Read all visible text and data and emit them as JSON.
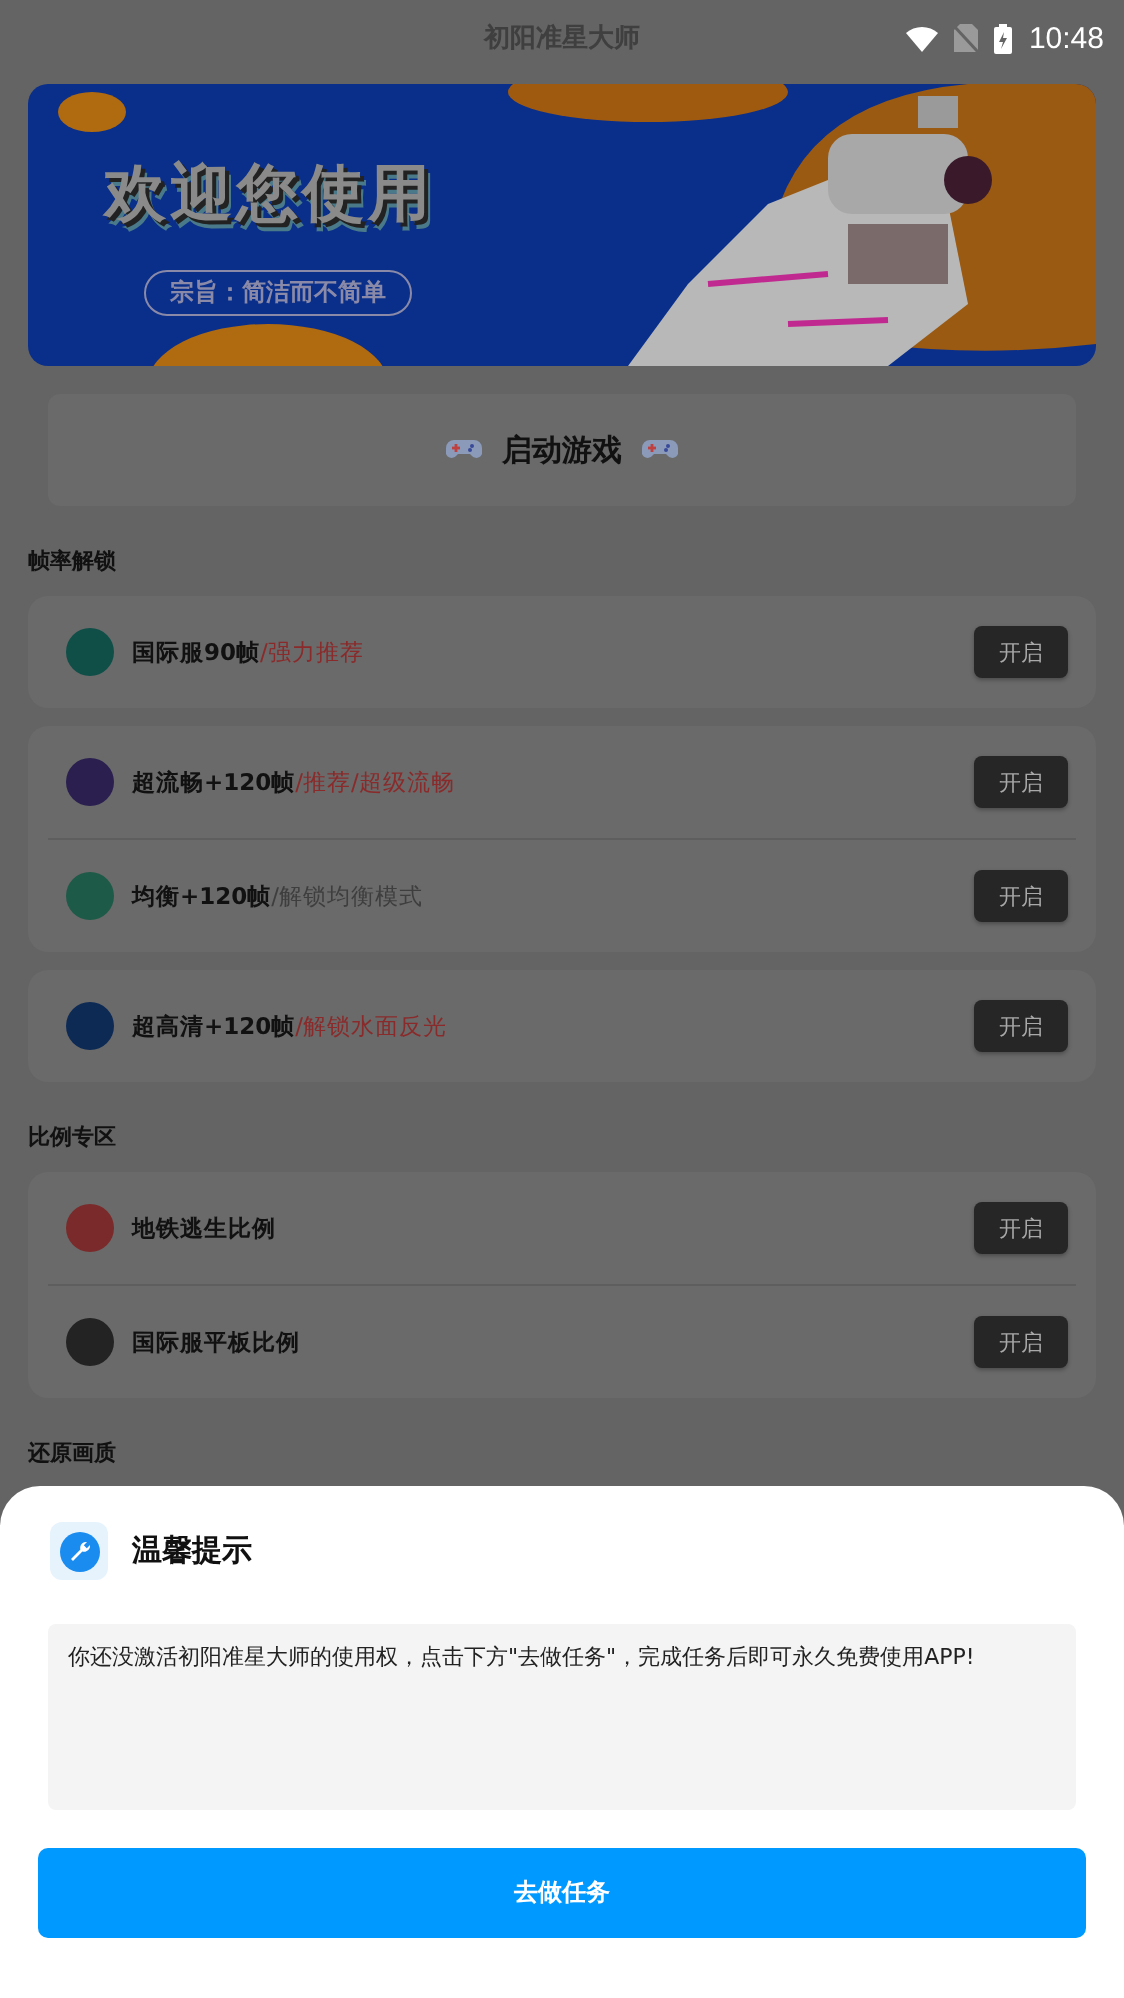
{
  "status_bar": {
    "time": "10:48"
  },
  "app_bar": {
    "title": "初阳准星大师"
  },
  "banner": {
    "kind": "picture",
    "title": "欢迎您使用",
    "tagline": "宗旨：简洁而不简单"
  },
  "launch": {
    "label": "启动游戏"
  },
  "sections": [
    {
      "title": "帧率解锁",
      "groups": [
        [
          {
            "name": "国际服90帧",
            "tag": {
              "text": "/强力推荐",
              "color": "#8a2a2a"
            },
            "icon": {
              "color": "#0f4f48"
            },
            "button": "开启"
          }
        ],
        [
          {
            "name": "超流畅+120帧",
            "tag": {
              "text": "/推荐/超级流畅",
              "color": "#8a2a2a"
            },
            "icon": {
              "color": "#2a1f4f"
            },
            "button": "开启"
          },
          {
            "name": "均衡+120帧",
            "tag": {
              "text": "/解锁均衡模式",
              "color": "#3e3e3e"
            },
            "icon": {
              "color": "#1e5a48"
            },
            "button": "开启"
          }
        ],
        [
          {
            "name": "超高清+120帧",
            "tag": {
              "text": "/解锁水面反光",
              "color": "#8a2a2a"
            },
            "icon": {
              "color": "#0d2a55"
            },
            "button": "开启"
          }
        ]
      ]
    },
    {
      "title": "比例专区",
      "groups": [
        [
          {
            "name": "地铁逃生比例",
            "icon": {
              "color": "#7a2a2a"
            },
            "button": "开启"
          },
          {
            "name": "国际服平板比例",
            "icon": {
              "color": "#232323"
            },
            "button": "开启"
          }
        ]
      ]
    },
    {
      "title": "还原画质"
    }
  ],
  "dialog": {
    "title": "温馨提示",
    "message": "你还没激活初阳准星大师的使用权，点击下方\"去做任务\"，完成任务后即可永久免费使用APP!",
    "button": "去做任务"
  }
}
